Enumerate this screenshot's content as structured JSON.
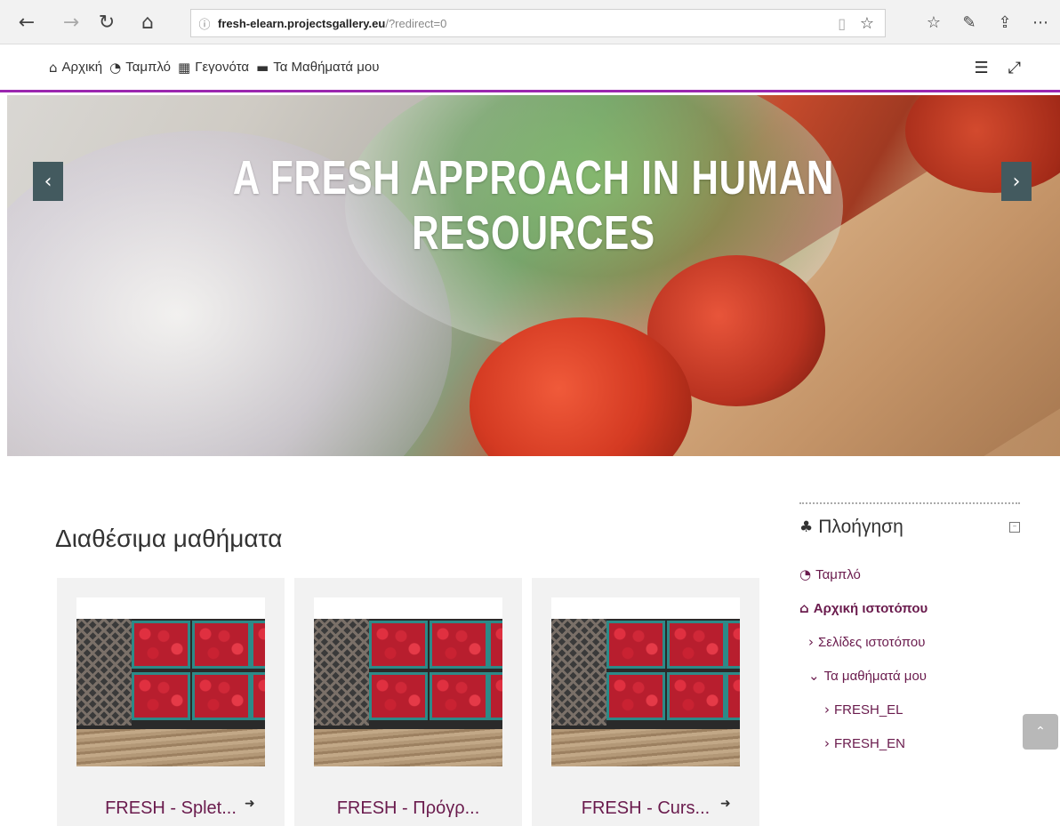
{
  "browser": {
    "url_host": "fresh-elearn.projectsgallery.eu",
    "url_path": "/?redirect=0"
  },
  "site_nav": {
    "items": [
      {
        "label": "Αρχική",
        "icon": "home-icon"
      },
      {
        "label": "Ταμπλό",
        "icon": "dashboard-icon"
      },
      {
        "label": "Γεγονότα",
        "icon": "calendar-icon"
      },
      {
        "label": "Τα Μαθήματά μου",
        "icon": "briefcase-icon"
      }
    ]
  },
  "hero": {
    "title": "A FRESH APPROACH IN HUMAN RESOURCES"
  },
  "main": {
    "section_title": "Διαθέσιμα μαθήματα",
    "courses": [
      {
        "name": "FRESH - Splet...",
        "enrol": true
      },
      {
        "name": "FRESH - Πρόγρ...",
        "enrol": false
      },
      {
        "name": "FRESH - Curs...",
        "enrol": true
      }
    ]
  },
  "navigation_block": {
    "title": "Πλοήγηση",
    "items": [
      {
        "label": "Ταμπλό",
        "icon": "dashboard-icon"
      },
      {
        "label": "Αρχική ιστοτόπου",
        "icon": "home-icon"
      },
      {
        "label": "Σελίδες ιστοτόπου",
        "icon": "chevron-right-icon"
      },
      {
        "label": "Τα μαθήματά μου",
        "icon": "chevron-down-icon"
      },
      {
        "label": "FRESH_EL",
        "icon": "chevron-right-icon"
      },
      {
        "label": "FRESH_EN",
        "icon": "chevron-right-icon"
      }
    ]
  },
  "colors": {
    "accent": "#9b27af",
    "link": "#6a1b4d",
    "slider_arrow": "#435a5f"
  }
}
